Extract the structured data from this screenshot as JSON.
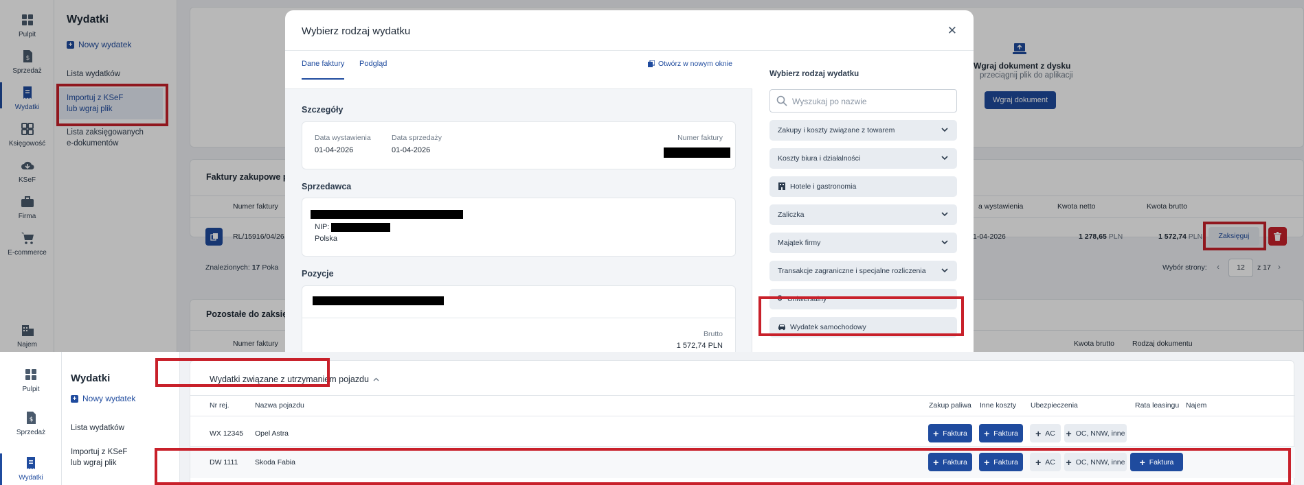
{
  "top": {
    "rail": [
      {
        "label": "Pulpit",
        "icon": "dashboard-icon"
      },
      {
        "label": "Sprzedaż",
        "icon": "document-money-icon"
      },
      {
        "label": "Wydatki",
        "icon": "receipt-icon",
        "active": true
      },
      {
        "label": "Księgowość",
        "icon": "grid-icon"
      },
      {
        "label": "KSeF",
        "icon": "cloud-download-icon"
      },
      {
        "label": "Firma",
        "icon": "briefcase-icon"
      },
      {
        "label": "E-commerce",
        "icon": "cart-icon"
      },
      {
        "label": "Najem",
        "icon": "building-icon"
      }
    ],
    "subnav": {
      "title": "Wydatki",
      "new_label": "Nowy wydatek",
      "items": [
        "Lista wydatków",
        "Importuj z KSeF\nlub wgraj plik",
        "Lista zaksięgowanych\ne-dokumentów"
      ]
    },
    "background": {
      "upload_title": "Wgraj dokument z dysku",
      "upload_hint": "przeciągnij plik do aplikacji",
      "upload_button": "Wgraj dokument",
      "purchases_title": "Faktury zakupowe p",
      "col_invoice_no": "Numer faktury",
      "col_issue_date": "a wystawienia",
      "col_net": "Kwota netto",
      "col_gross": "Kwota brutto",
      "row_invoice_no": "RL/15916/04/26",
      "row_issue_date": "1-04-2026",
      "row_net": "1 278,65",
      "row_gross": "1 572,74",
      "currency": "PLN",
      "book_button": "Zaksięguj",
      "found_label": "Znalezionych:",
      "found_count": "17",
      "found_tail": "Poka",
      "page_label": "Wybór strony:",
      "page_current": "12",
      "page_of": "z",
      "page_total": "17",
      "remaining_title": "Pozostałe do zaksię",
      "col_invoice_no2": "Numer faktury",
      "col_gross2": "Kwota brutto",
      "col_doc_type": "Rodzaj dokumentu"
    },
    "modal": {
      "title": "Wybierz rodzaj wydatku",
      "close": "✕",
      "tabs": [
        "Dane faktury",
        "Podgląd"
      ],
      "open_new_window": "Otwórz w nowym oknie",
      "details": {
        "heading": "Szczegóły",
        "issue_date_label": "Data wystawienia",
        "issue_date": "01-04-2026",
        "sale_date_label": "Data sprzedaży",
        "sale_date": "01-04-2026",
        "invoice_no_label": "Numer faktury"
      },
      "seller": {
        "heading": "Sprzedawca",
        "nip_label": "NIP:",
        "country": "Polska"
      },
      "items": {
        "heading": "Pozycje",
        "gross_label": "Brutto",
        "gross_value": "1 572,74 PLN"
      },
      "right": {
        "title": "Wybierz rodzaj wydatku",
        "search_placeholder": "Wyszukaj po nazwie",
        "categories": [
          {
            "label": "Zakupy i koszty związane z towarem",
            "chevron": true
          },
          {
            "label": "Koszty biura i działalności",
            "chevron": true
          },
          {
            "label": "Hotele i gastronomia",
            "icon": "hotel-icon"
          },
          {
            "label": "Zaliczka",
            "chevron": true
          },
          {
            "label": "Majątek firmy",
            "chevron": true
          },
          {
            "label": "Transakcje zagraniczne i specjalne rozliczenia",
            "chevron": true
          },
          {
            "label": "Uniwersalny",
            "icon": "dollar-icon"
          },
          {
            "label": "Wydatek samochodowy",
            "icon": "car-icon"
          }
        ]
      }
    }
  },
  "bottom": {
    "rail": [
      {
        "label": "Pulpit",
        "icon": "dashboard-icon"
      },
      {
        "label": "Sprzedaż",
        "icon": "document-money-icon"
      },
      {
        "label": "Wydatki",
        "icon": "receipt-icon",
        "active": true
      }
    ],
    "subnav": {
      "title": "Wydatki",
      "new_label": "Nowy wydatek",
      "items": [
        "Lista wydatków",
        "Importuj z KSeF\nlub wgraj plik"
      ]
    },
    "vehicles": {
      "title": "Wydatki związane z utrzymaniem pojazdu",
      "columns": [
        "Nr rej.",
        "Nazwa pojazdu",
        "Zakup paliwa",
        "Inne koszty",
        "Ubezpieczenia",
        "Rata leasingu",
        "Najem"
      ],
      "rows": [
        {
          "reg": "WX 12345",
          "name": "Opel Astra",
          "fuel": "Faktura",
          "other": "Faktura",
          "ins_ac": "AC",
          "ins_oc": "OC, NNW, inne",
          "leasing": ""
        },
        {
          "reg": "DW 1111",
          "name": "Skoda Fabia",
          "fuel": "Faktura",
          "other": "Faktura",
          "ins_ac": "AC",
          "ins_oc": "OC, NNW, inne",
          "leasing": "Faktura"
        }
      ]
    }
  },
  "colors": {
    "accent": "#1f4b9e",
    "highlight": "#c8202a",
    "danger": "#c8202a"
  }
}
